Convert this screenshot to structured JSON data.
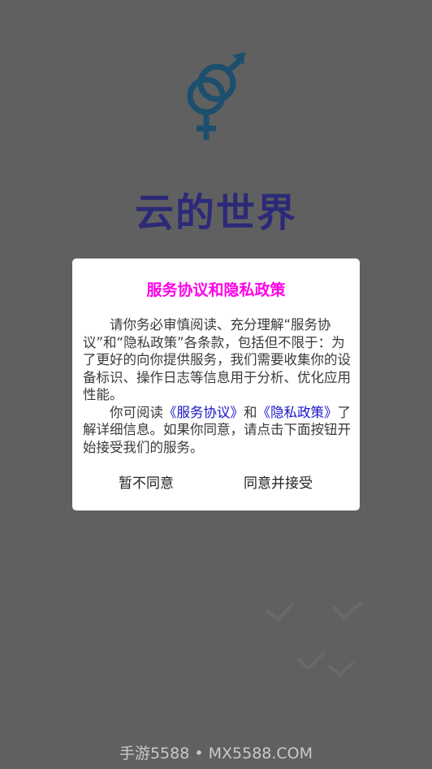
{
  "app": {
    "name": "云的世界"
  },
  "dialog": {
    "title": "服务协议和隐私政策",
    "paragraph1": "请你务必审慎阅读、充分理解“服务协议”和“隐私政策”各条款，包括但不限于：为了更好的向你提供服务，我们需要收集你的设备标识、操作日志等信息用于分析、优化应用性能。",
    "paragraph2_prefix": "你可阅读",
    "link_service": "《服务协议》",
    "paragraph2_and": "和",
    "link_privacy": "《隐私政策》",
    "paragraph2_suffix": "了解详细信息。如果你同意，请点击下面按钮开始接受我们的服务。",
    "decline_label": "暂不同意",
    "accept_label": "同意并接受"
  },
  "watermark": "手游5588 • MX5588.COM",
  "colors": {
    "background": "#606060",
    "title_magenta": "#ff00e8",
    "link_blue": "#1a14c8",
    "logo_blue": "#1c4f6e",
    "app_name": "#2c2a78"
  },
  "icons": {
    "logo": "gender-symbols-icon",
    "decoration": "birds-icon"
  }
}
